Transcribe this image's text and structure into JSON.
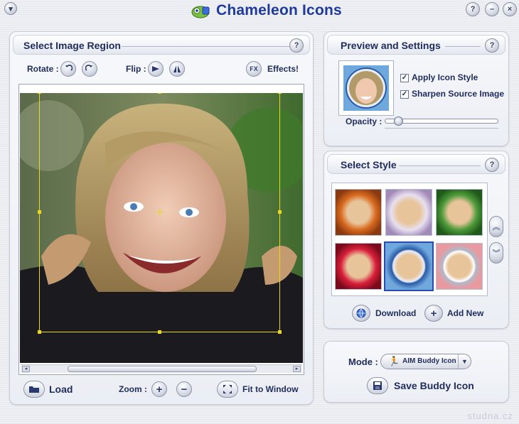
{
  "app": {
    "title": "Chameleon Icons"
  },
  "select_region": {
    "title": "Select Image Region",
    "rotate_label": "Rotate :",
    "flip_label": "Flip :",
    "effects_label": "Effects!",
    "fx_icon_text": "FX",
    "load_label": "Load",
    "zoom_label": "Zoom :",
    "fit_label": "Fit to Window"
  },
  "preview": {
    "title": "Preview and Settings",
    "apply_icon_style": {
      "label": "Apply Icon Style",
      "checked": true
    },
    "sharpen_source": {
      "label": "Sharpen Source Image",
      "checked": true
    },
    "opacity_label": "Opacity :",
    "opacity_value": 0.12
  },
  "select_style": {
    "title": "Select Style",
    "styles": [
      {
        "name": "autumn-leaves"
      },
      {
        "name": "flower-frame"
      },
      {
        "name": "green-leaves"
      },
      {
        "name": "red-roses"
      },
      {
        "name": "blue-circle",
        "selected": true
      },
      {
        "name": "sunset-circle"
      }
    ],
    "download_label": "Download",
    "add_new_label": "Add New"
  },
  "mode": {
    "label": "Mode :",
    "selected": "AIM Buddy Icon",
    "save_label": "Save Buddy Icon"
  },
  "watermark": "studna.cz",
  "icons": {
    "menu": "chevron-down-icon",
    "help": "question-icon",
    "minimize": "minimize-icon",
    "close": "close-icon"
  }
}
